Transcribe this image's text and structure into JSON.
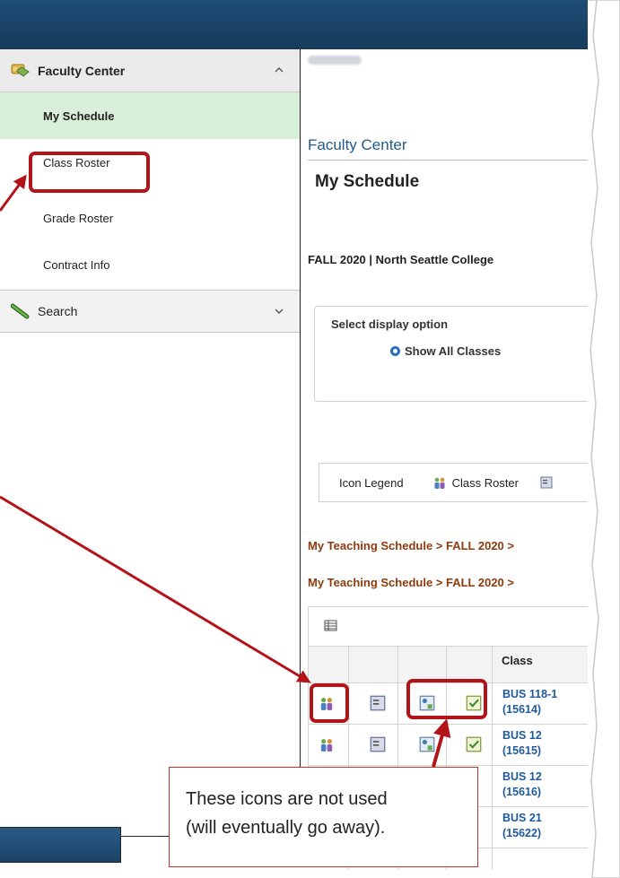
{
  "left_nav": {
    "faculty_center": "Faculty Center",
    "items": [
      {
        "label": "My Schedule",
        "active": true
      },
      {
        "label": "Class Roster",
        "active": false
      },
      {
        "label": "Grade Roster",
        "active": false
      },
      {
        "label": "Contract Info",
        "active": false
      }
    ],
    "search": "Search"
  },
  "main": {
    "section_title": "Faculty Center",
    "page_title": "My Schedule",
    "term": "FALL 2020 | North Seattle College",
    "display_option_label": "Select display option",
    "display_option_value": "Show All Classes",
    "legend_label": "Icon Legend",
    "legend_class_roster": "Class Roster",
    "breadcrumb_1": "My Teaching Schedule > FALL 2020 > ",
    "breadcrumb_2": "My Teaching Schedule > FALL 2020 >",
    "class_header": "Class",
    "rows": [
      {
        "code": "BUS 118-1",
        "number": "(15614)"
      },
      {
        "code": "BUS 12",
        "number": "(15615)"
      },
      {
        "code": "BUS 12",
        "number": "(15616)"
      },
      {
        "code": "BUS 21",
        "number": "(15622)"
      }
    ]
  },
  "callout": {
    "line1": "These icons are not used",
    "line2": "(will eventually go away)."
  },
  "colors": {
    "banner": "#1f4d75",
    "active_nav": "#d8efd9",
    "link": "#1f5a9c",
    "breadcrumb": "#8b3b0e",
    "highlight": "#b2141a"
  }
}
